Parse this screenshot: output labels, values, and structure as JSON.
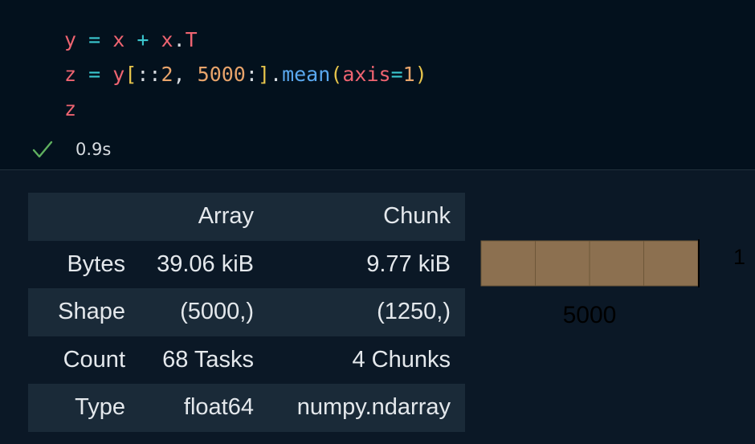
{
  "code_lines": [
    [
      {
        "t": "y",
        "c": "var"
      },
      {
        "t": " ",
        "c": "punc"
      },
      {
        "t": "=",
        "c": "op"
      },
      {
        "t": " ",
        "c": "punc"
      },
      {
        "t": "x",
        "c": "var"
      },
      {
        "t": " ",
        "c": "punc"
      },
      {
        "t": "+",
        "c": "op"
      },
      {
        "t": " ",
        "c": "punc"
      },
      {
        "t": "x",
        "c": "var"
      },
      {
        "t": ".",
        "c": "punc"
      },
      {
        "t": "T",
        "c": "var"
      }
    ],
    [
      {
        "t": "z",
        "c": "var"
      },
      {
        "t": " ",
        "c": "punc"
      },
      {
        "t": "=",
        "c": "op"
      },
      {
        "t": " ",
        "c": "punc"
      },
      {
        "t": "y",
        "c": "var"
      },
      {
        "t": "[",
        "c": "br1"
      },
      {
        "t": "::",
        "c": "punc"
      },
      {
        "t": "2",
        "c": "num"
      },
      {
        "t": ", ",
        "c": "punc"
      },
      {
        "t": "5000",
        "c": "num"
      },
      {
        "t": ":",
        "c": "punc"
      },
      {
        "t": "]",
        "c": "br1"
      },
      {
        "t": ".",
        "c": "punc"
      },
      {
        "t": "mean",
        "c": "fn"
      },
      {
        "t": "(",
        "c": "br1"
      },
      {
        "t": "axis",
        "c": "var"
      },
      {
        "t": "=",
        "c": "op"
      },
      {
        "t": "1",
        "c": "num"
      },
      {
        "t": ")",
        "c": "br1"
      }
    ],
    [
      {
        "t": "z",
        "c": "var"
      }
    ]
  ],
  "status": {
    "icon": "check-icon",
    "icon_color": "#5fb05f",
    "duration": "0.9s"
  },
  "table": {
    "headers": [
      "",
      "Array",
      "Chunk"
    ],
    "rows": [
      [
        "Bytes",
        "39.06 kiB",
        "9.77 kiB"
      ],
      [
        "Shape",
        "(5000,)",
        "(1250,)"
      ],
      [
        "Count",
        "68 Tasks",
        "4 Chunks"
      ],
      [
        "Type",
        "float64",
        "numpy.ndarray"
      ]
    ]
  },
  "chunk_viz": {
    "chunks": 4,
    "fill_color": "#8c7050",
    "label_bottom": "5000",
    "label_right": "1"
  }
}
